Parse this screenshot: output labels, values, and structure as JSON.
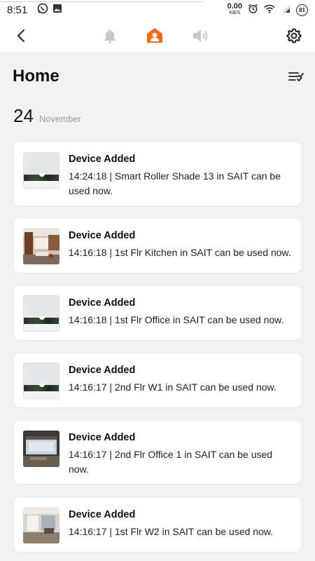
{
  "status_bar": {
    "time": "8:51",
    "speed_value": "0.00",
    "speed_unit": "KB/S",
    "battery_label": "81"
  },
  "header": {
    "back": "back-icon",
    "tabs": [
      "bell-icon",
      "person-home-icon",
      "speaker-icon"
    ],
    "active_tab": 1,
    "settings": "gear-icon"
  },
  "colors": {
    "accent": "#f26b1d",
    "inactive": "#c8c8c8",
    "background": "#f2f2f2"
  },
  "page": {
    "title": "Home"
  },
  "date": {
    "day": "24",
    "month": "November"
  },
  "notifications": [
    {
      "title": "Device Added",
      "message": "14:24:18 | Smart Roller Shade 13 in SAIT can be used now.",
      "thumbnail": "roller-shade"
    },
    {
      "title": "Device Added",
      "message": "14:16:18 | 1st Flr Kitchen in SAIT can be used now.",
      "thumbnail": "kitchen-photo"
    },
    {
      "title": "Device Added",
      "message": "14:16:18 | 1st Flr Office in SAIT can be used now.",
      "thumbnail": "roller-shade"
    },
    {
      "title": "Device Added",
      "message": "14:16:17 | 2nd Flr W1 in SAIT can be used now.",
      "thumbnail": "roller-shade"
    },
    {
      "title": "Device Added",
      "message": "14:16:17 | 2nd Flr Office 1 in SAIT can be used now.",
      "thumbnail": "office-photo"
    },
    {
      "title": "Device Added",
      "message": "14:16:17 | 1st Flr W2 in SAIT can be used now.",
      "thumbnail": "room-photo"
    }
  ]
}
